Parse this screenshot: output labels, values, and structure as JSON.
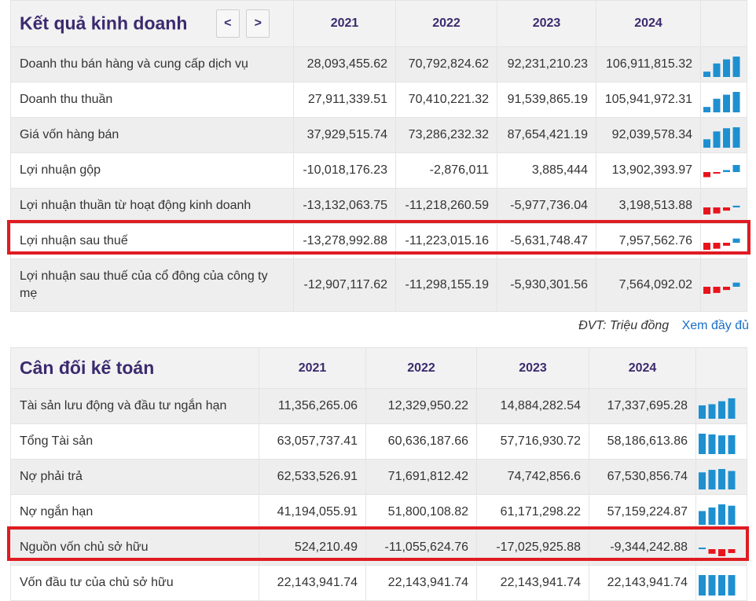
{
  "income": {
    "title": "Kết quả kinh doanh",
    "prev_label": "<",
    "next_label": ">",
    "years": [
      "2021",
      "2022",
      "2023",
      "2024"
    ],
    "rows": [
      {
        "label": "Doanh thu bán hàng và cung cấp dịch vụ",
        "values": [
          "28,093,455.62",
          "70,792,824.62",
          "92,231,210.23",
          "106,911,815.32"
        ],
        "nums": [
          28093455.62,
          70792824.62,
          92231210.23,
          106911815.32
        ]
      },
      {
        "label": "Doanh thu thuần",
        "values": [
          "27,911,339.51",
          "70,410,221.32",
          "91,539,865.19",
          "105,941,972.31"
        ],
        "nums": [
          27911339.51,
          70410221.32,
          91539865.19,
          105941972.31
        ]
      },
      {
        "label": "Giá vốn hàng bán",
        "values": [
          "37,929,515.74",
          "73,286,232.32",
          "87,654,421.19",
          "92,039,578.34"
        ],
        "nums": [
          37929515.74,
          73286232.32,
          87654421.19,
          92039578.34
        ]
      },
      {
        "label": "Lợi nhuận gộp",
        "values": [
          "-10,018,176.23",
          "-2,876,011",
          "3,885,444",
          "13,902,393.97"
        ],
        "nums": [
          -10018176.23,
          -2876011,
          3885444,
          13902393.97
        ]
      },
      {
        "label": "Lợi nhuận thuần từ hoạt động kinh doanh",
        "values": [
          "-13,132,063.75",
          "-11,218,260.59",
          "-5,977,736.04",
          "3,198,513.88"
        ],
        "nums": [
          -13132063.75,
          -11218260.59,
          -5977736.04,
          3198513.88
        ]
      },
      {
        "label": "Lợi nhuận sau thuế",
        "values": [
          "-13,278,992.88",
          "-11,223,015.16",
          "-5,631,748.47",
          "7,957,562.76"
        ],
        "nums": [
          -13278992.88,
          -11223015.16,
          -5631748.47,
          7957562.76
        ]
      },
      {
        "label": "Lợi nhuận sau thuế của cổ đông của công ty mẹ",
        "values": [
          "-12,907,117.62",
          "-11,298,155.19",
          "-5,930,301.56",
          "7,564,092.02"
        ],
        "nums": [
          -12907117.62,
          -11298155.19,
          -5930301.56,
          7564092.02
        ]
      }
    ]
  },
  "footer": {
    "unit_label": "ĐVT: Triệu đồng",
    "see_more_label": "Xem đầy đủ"
  },
  "balance": {
    "title": "Cân đối kế toán",
    "years": [
      "2021",
      "2022",
      "2023",
      "2024"
    ],
    "rows": [
      {
        "label": "Tài sản lưu động và đầu tư ngắn hạn",
        "values": [
          "11,356,265.06",
          "12,329,950.22",
          "14,884,282.54",
          "17,337,695.28"
        ],
        "nums": [
          11356265.06,
          12329950.22,
          14884282.54,
          17337695.28
        ]
      },
      {
        "label": "Tổng Tài sản",
        "values": [
          "63,057,737.41",
          "60,636,187.66",
          "57,716,930.72",
          "58,186,613.86"
        ],
        "nums": [
          63057737.41,
          60636187.66,
          57716930.72,
          58186613.86
        ]
      },
      {
        "label": "Nợ phải trả",
        "values": [
          "62,533,526.91",
          "71,691,812.42",
          "74,742,856.6",
          "67,530,856.74"
        ],
        "nums": [
          62533526.91,
          71691812.42,
          74742856.6,
          67530856.74
        ]
      },
      {
        "label": "Nợ ngắn hạn",
        "values": [
          "41,194,055.91",
          "51,800,108.82",
          "61,171,298.22",
          "57,159,224.87"
        ],
        "nums": [
          41194055.91,
          51800108.82,
          61171298.22,
          57159224.87
        ]
      },
      {
        "label": "Nguồn vốn chủ sở hữu",
        "values": [
          "524,210.49",
          "-11,055,624.76",
          "-17,025,925.88",
          "-9,344,242.88"
        ],
        "nums": [
          524210.49,
          -11055624.76,
          -17025925.88,
          -9344242.88
        ]
      },
      {
        "label": "Vốn đầu tư của chủ sở hữu",
        "values": [
          "22,143,941.74",
          "22,143,941.74",
          "22,143,941.74",
          "22,143,941.74"
        ],
        "nums": [
          22143941.74,
          22143941.74,
          22143941.74,
          22143941.74
        ]
      }
    ]
  },
  "colors": {
    "positive_bar": "#1e90d0",
    "negative_bar": "#e8141c",
    "highlight_box": "#e01b22",
    "header_text": "#3b2a6e",
    "link": "#1a6fc9"
  }
}
